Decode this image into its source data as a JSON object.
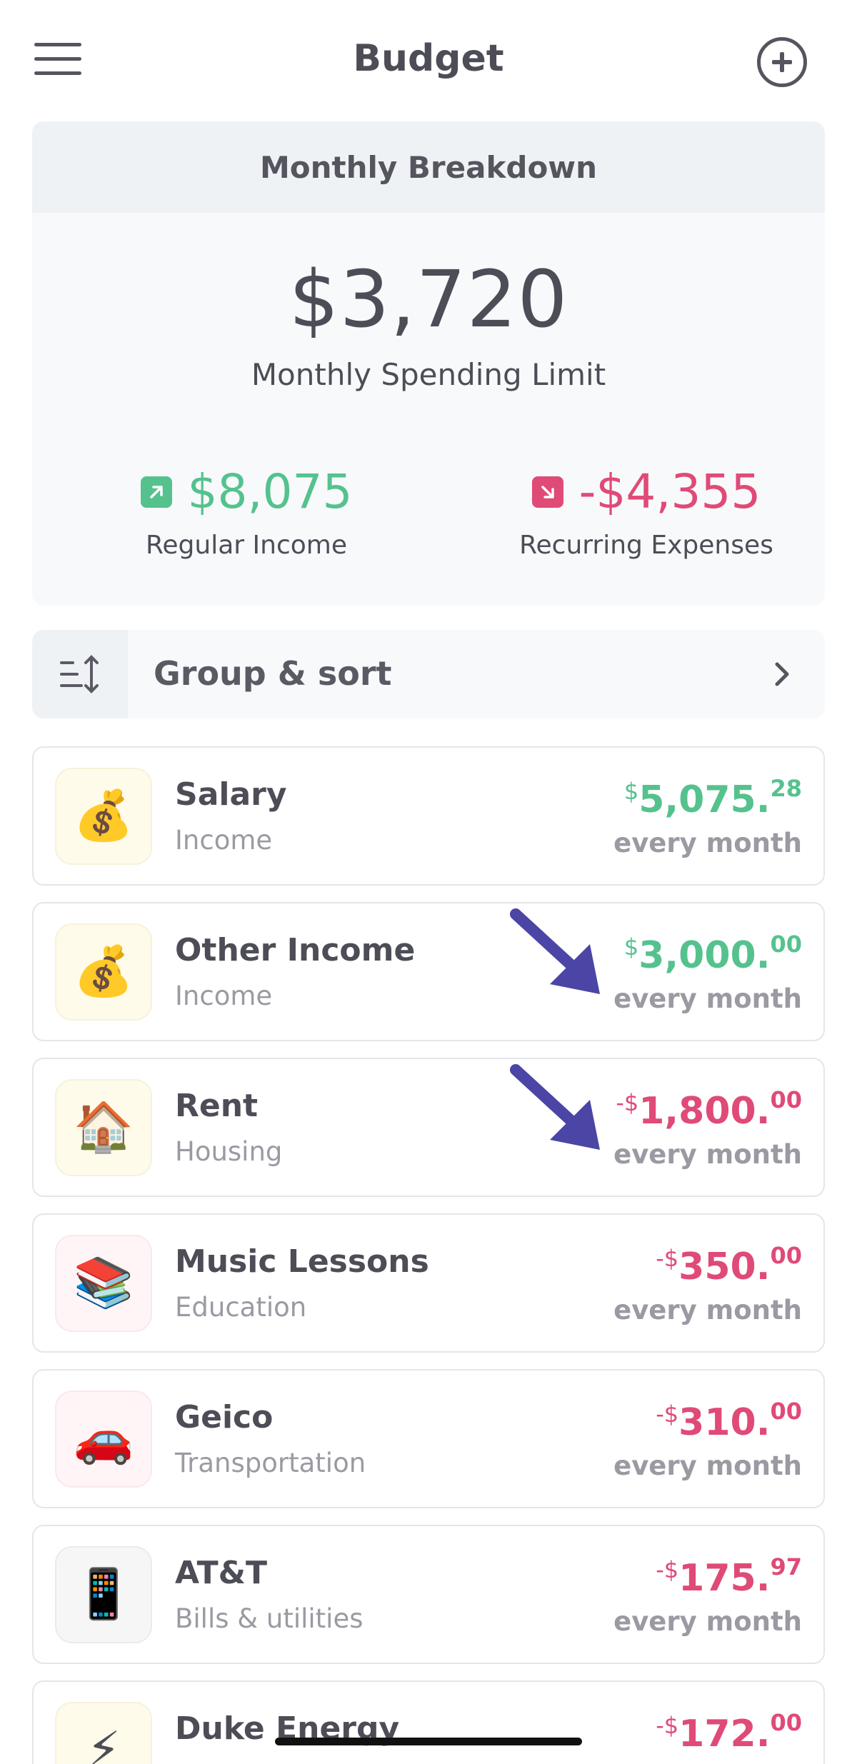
{
  "header": {
    "title": "Budget",
    "menu_icon": "hamburger-menu-icon",
    "add_icon": "plus-circle-icon"
  },
  "breakdown": {
    "heading": "Monthly Breakdown",
    "limit_amount": "$3,720",
    "limit_label": "Monthly Spending Limit",
    "income": {
      "value": "$8,075",
      "label": "Regular Income",
      "icon": "arrow-up-right-icon"
    },
    "expenses": {
      "value": "-$4,355",
      "label": "Recurring Expenses",
      "icon": "arrow-down-right-icon"
    }
  },
  "group_sort": {
    "label": "Group & sort",
    "icon": "sort-icon"
  },
  "items": [
    {
      "emoji": "💰",
      "name": "Salary",
      "category": "Income",
      "currency": "$",
      "amount": "5,075.",
      "cents": "28",
      "frequency": "every month"
    },
    {
      "emoji": "💰",
      "name": "Other Income",
      "category": "Income",
      "currency": "$",
      "amount": "3,000.",
      "cents": "00",
      "frequency": "every month"
    },
    {
      "emoji": "🏠",
      "name": "Rent",
      "category": "Housing",
      "currency": "-$",
      "amount": "1,800.",
      "cents": "00",
      "frequency": "every month"
    },
    {
      "emoji": "📚",
      "name": "Music Lessons",
      "category": "Education",
      "currency": "-$",
      "amount": "350.",
      "cents": "00",
      "frequency": "every month"
    },
    {
      "emoji": "🚗",
      "name": "Geico",
      "category": "Transportation",
      "currency": "-$",
      "amount": "310.",
      "cents": "00",
      "frequency": "every month"
    },
    {
      "emoji": "📱",
      "name": "AT&T",
      "category": "Bills & utilities",
      "currency": "-$",
      "amount": "175.",
      "cents": "97",
      "frequency": "every month"
    },
    {
      "emoji": "⚡",
      "name": "Duke Energy",
      "category": "",
      "currency": "-$",
      "amount": "172.",
      "cents": "00",
      "frequency": ""
    }
  ],
  "colors": {
    "positive": "#55c28e",
    "negative": "#e04a77",
    "annotation_arrow": "#4b45a6"
  }
}
